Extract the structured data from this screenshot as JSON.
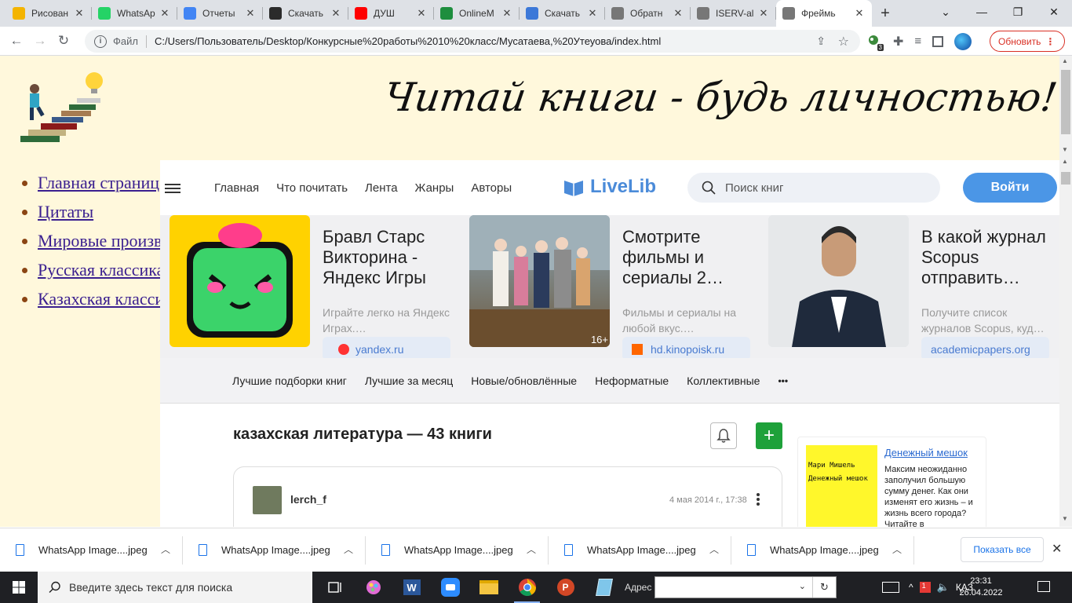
{
  "tabs": [
    {
      "label": "Рисован",
      "color": "#f4b400",
      "icon": "drawings-icon"
    },
    {
      "label": "WhatsAp",
      "color": "#25d366",
      "icon": "whatsapp-icon"
    },
    {
      "label": "Отчеты",
      "color": "#4285f4",
      "icon": "reports-icon"
    },
    {
      "label": "Скачать",
      "color": "#2b2b2b",
      "icon": "s-download-icon"
    },
    {
      "label": "ДУШ",
      "color": "#ff0000",
      "icon": "youtube-icon"
    },
    {
      "label": "OnlineM",
      "color": "#1e8e3e",
      "icon": "online-icon"
    },
    {
      "label": "Скачать",
      "color": "#3c78d8",
      "icon": "download-site-icon"
    },
    {
      "label": "Обратн",
      "color": "#777777",
      "icon": "globe-icon"
    },
    {
      "label": "ISERV-al",
      "color": "#777777",
      "icon": "globe-icon"
    },
    {
      "label": "Фреймь",
      "color": "#777777",
      "icon": "globe-icon",
      "active": true
    }
  ],
  "toolbar": {
    "file_label": "Файл",
    "url": "C:/Users/Пользователь/Desktop/Конкурсные%20работы%2010%20класс/Мусатаева,%20Утеуова/index.html",
    "update_label": "Обновить",
    "ext_badge": "3"
  },
  "page": {
    "banner": "Читай книги - будь личностью!",
    "menu": [
      "Главная страница",
      "Цитаты",
      "Мировые произведения",
      "Русская классика",
      "Казахская классика"
    ]
  },
  "livelib": {
    "nav": [
      "Главная",
      "Что почитать",
      "Лента",
      "Жанры",
      "Авторы"
    ],
    "logo": "LiveLib",
    "search_placeholder": "Поиск книг",
    "login": "Войти",
    "ads": [
      {
        "title": "Бравл Старс Викторина - Яндекс Игры",
        "desc": "Играйте легко на Яндекс Играх.…",
        "domain": "yandex.ru"
      },
      {
        "title": "Смотрите фильмы и сериалы 2…",
        "desc": "Фильмы и сериалы на любой вкус.…",
        "domain": "hd.kinopoisk.ru",
        "age": "16+"
      },
      {
        "title": "В какой журнал Scopus отправить…",
        "desc": "Получите список журналов Scopus, куд…",
        "domain": "academicpapers.org"
      }
    ],
    "categories": [
      "Лучшие подборки книг",
      "Лучшие за месяц",
      "Новые/обновлённые",
      "Неформатные",
      "Коллективные",
      "•••"
    ],
    "list_title": "казахская литература — 43 книги",
    "post": {
      "user": "lerch_f",
      "date": "4 мая 2014 г., 17:38"
    },
    "side_book": {
      "cover_author": "Мари Мишель",
      "cover_title": "Денежный мешок",
      "link": "Денежный мешок",
      "desc": "Максим неожиданно заполучил большую сумму денег. Как они изменят его жизнь – и жизнь всего города? Читайте в"
    }
  },
  "downloads": {
    "items": [
      "WhatsApp Image....jpeg",
      "WhatsApp Image....jpeg",
      "WhatsApp Image....jpeg",
      "WhatsApp Image....jpeg",
      "WhatsApp Image....jpeg"
    ],
    "show_all": "Показать все"
  },
  "taskbar": {
    "search_placeholder": "Введите здесь текст для поиска",
    "address_label": "Адрес",
    "lang": "ҚАЗ",
    "time": "23:31",
    "date": "26.04.2022",
    "notif_badge": "1"
  }
}
